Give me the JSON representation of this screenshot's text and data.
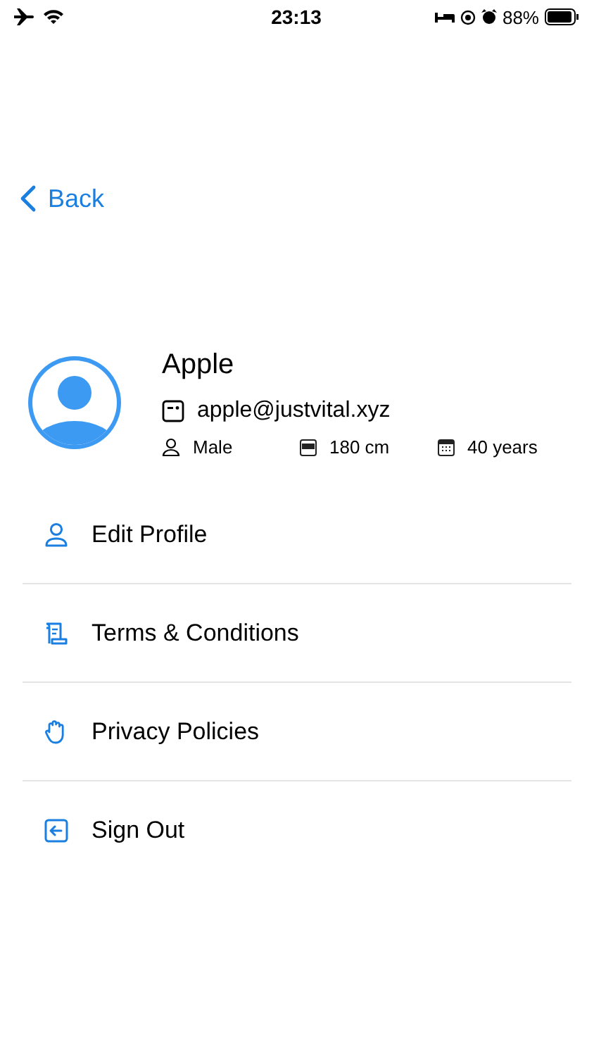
{
  "status_bar": {
    "time": "23:13",
    "battery": "88%"
  },
  "nav": {
    "back": "Back"
  },
  "profile": {
    "name": "Apple",
    "email": "apple@justvital.xyz",
    "gender": "Male",
    "height": "180 cm",
    "age": "40 years"
  },
  "menu": [
    {
      "kind": "person",
      "label": "Edit Profile"
    },
    {
      "kind": "scroll",
      "label": "Terms & Conditions"
    },
    {
      "kind": "hand",
      "label": "Privacy Policies"
    },
    {
      "kind": "signout",
      "label": "Sign Out"
    }
  ]
}
